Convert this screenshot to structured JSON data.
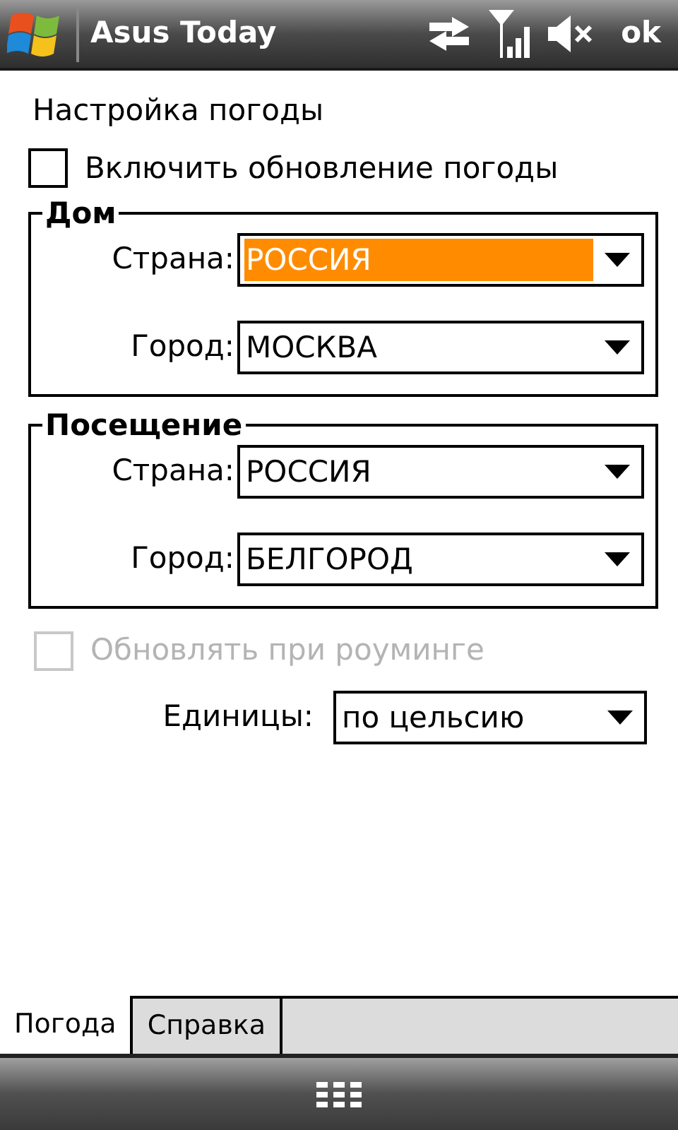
{
  "title_bar": {
    "title": "Asus Today",
    "ok_label": "ok"
  },
  "heading": "Настройка погоды",
  "enable_weather": {
    "label": "Включить обновление погоды",
    "checked": false,
    "disabled": false
  },
  "groups": [
    {
      "title": "Дом",
      "fields": [
        {
          "label": "Страна:",
          "value": "РОССИЯ",
          "focused": true
        },
        {
          "label": "Город:",
          "value": "МОСКВА",
          "focused": false
        }
      ]
    },
    {
      "title": "Посещение",
      "fields": [
        {
          "label": "Страна:",
          "value": "РОССИЯ",
          "focused": false
        },
        {
          "label": "Город:",
          "value": "БЕЛГОРОД",
          "focused": false
        }
      ]
    }
  ],
  "roaming": {
    "label": "Обновлять при роуминге",
    "checked": false,
    "disabled": true
  },
  "units": {
    "label": "Единицы:",
    "value": "по цельсию",
    "focused": false
  },
  "tabs": [
    {
      "label": "Погода",
      "selected": true
    },
    {
      "label": "Справка",
      "selected": false
    }
  ]
}
